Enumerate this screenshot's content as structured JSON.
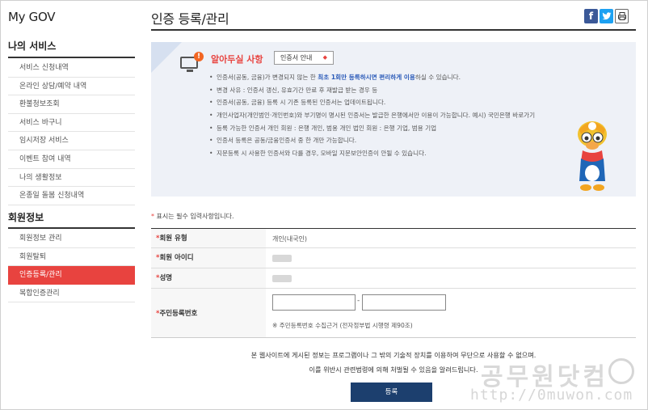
{
  "app_title": "My GOV",
  "sidebar": {
    "section1": "나의 서비스",
    "items1": [
      "서비스 신청내역",
      "온라인 상담/예약 내역",
      "환불청보조회",
      "서비스 바구니",
      "임시저장 서비스",
      "이벤트 참여 내역",
      "나의 생활정보",
      "온종일 돌봄 신청내역"
    ],
    "section2": "회원정보",
    "items2": [
      "회원정보 관리",
      "회원탈퇴",
      "인증등록/관리",
      "복합인증관리"
    ],
    "active_item": "인증등록/관리"
  },
  "page_title": "인증 등록/관리",
  "share_icons": [
    "facebook-icon",
    "twitter-icon",
    "print-icon"
  ],
  "notice": {
    "title": "알아두실 사항",
    "cert_button": "인증서 안내",
    "items": [
      {
        "pre": "인증서(공동, 금융)가 변경되지 않는 한 ",
        "strong": "최초 1회만 등록하시면 편리하게 이용",
        "post": "하실 수 있습니다."
      },
      {
        "pre": "변경 사유 : 인증서 갱신, 유효기간 만료 후 재발급 받는 경우 등",
        "strong": "",
        "post": ""
      },
      {
        "pre": "인증서(공동, 금융) 등록 시 기존 등록된 인증서는 업데이트됩니다.",
        "strong": "",
        "post": ""
      },
      {
        "pre": "개인사업자(개인범인·개인번호)와 부기명이 명시된 인증서는 발급한 은행에서만 이용이 가능합니다. 예시) 국민은행 바로가기",
        "strong": "",
        "post": ""
      },
      {
        "pre": "등록 가능한 인증서 개인 회원 : 은행 개인, 범용 개인 법인 회원 : 은행 기업, 범용 기업",
        "strong": "",
        "post": ""
      },
      {
        "pre": "인증서 등록은 공동/금융인증서 중 한 개만 가능합니다.",
        "strong": "",
        "post": ""
      },
      {
        "pre": "지문등록 시 사용한 인증서와 다를 경우, 모바일 지문보안인증이 안될 수 있습니다.",
        "strong": "",
        "post": ""
      }
    ]
  },
  "form": {
    "required_note": "표시는 필수 입력사항입니다.",
    "member_type_label": "회원 유형",
    "member_type_value": "개인(내국인)",
    "member_id_label": "회원 아이디",
    "name_label": "성명",
    "rrn_label": "주민등록번호",
    "rrn_separator": "-",
    "rrn_hint": "※ 주민등록번호 수집근거 (전자정부법 시행령 제90조)"
  },
  "warning_line1": "본 웹사이트에 게시된 정보는 프로그램이나 그 밖의 기술적 장치를 이용하여 무단으로 사용할 수 없으며.",
  "warning_line2": "이를 위반시 관련법령에 의해 처벌될 수 있음을 알려드립니다.",
  "submit_label": "등록",
  "watermark": {
    "line1": "공무원닷컴",
    "line2": "http://0muwon.com"
  }
}
